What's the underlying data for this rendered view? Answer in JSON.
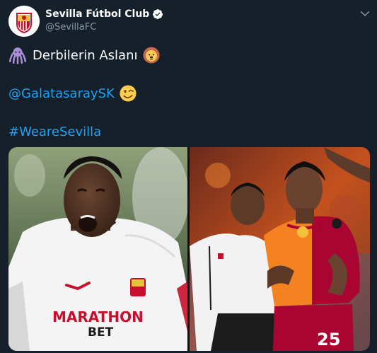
{
  "tweet": {
    "author": {
      "display_name": "Sevilla Fútbol Club",
      "handle": "@SevillaFC",
      "verified": true,
      "avatar_icon": "sevilla-crest-icon"
    },
    "caret_icon": "chevron-down-icon",
    "lines": [
      {
        "leading_icon": "octopus-emoji-icon",
        "text": "Derbilerin Aslanı",
        "trailing_icon": "lion-emoji-icon"
      },
      {
        "mention": "@GalatasaraySK",
        "trailing_icon": "winking-face-emoji-icon"
      }
    ],
    "hashtag": "#WeareSevilla",
    "media": {
      "left_photo": {
        "kit_brand": "MARATHON",
        "kit_sponsor": "BET",
        "kit_colors": [
          "#f4f4f4",
          "#c8102e"
        ]
      },
      "right_photo": {
        "kit_number": "25",
        "kit_colors": [
          "#f58220",
          "#a90432"
        ]
      }
    },
    "colors": {
      "background": "#15202b",
      "link": "#1da1f2",
      "secondary_text": "#8899a6",
      "verified": "#ffffff"
    }
  }
}
